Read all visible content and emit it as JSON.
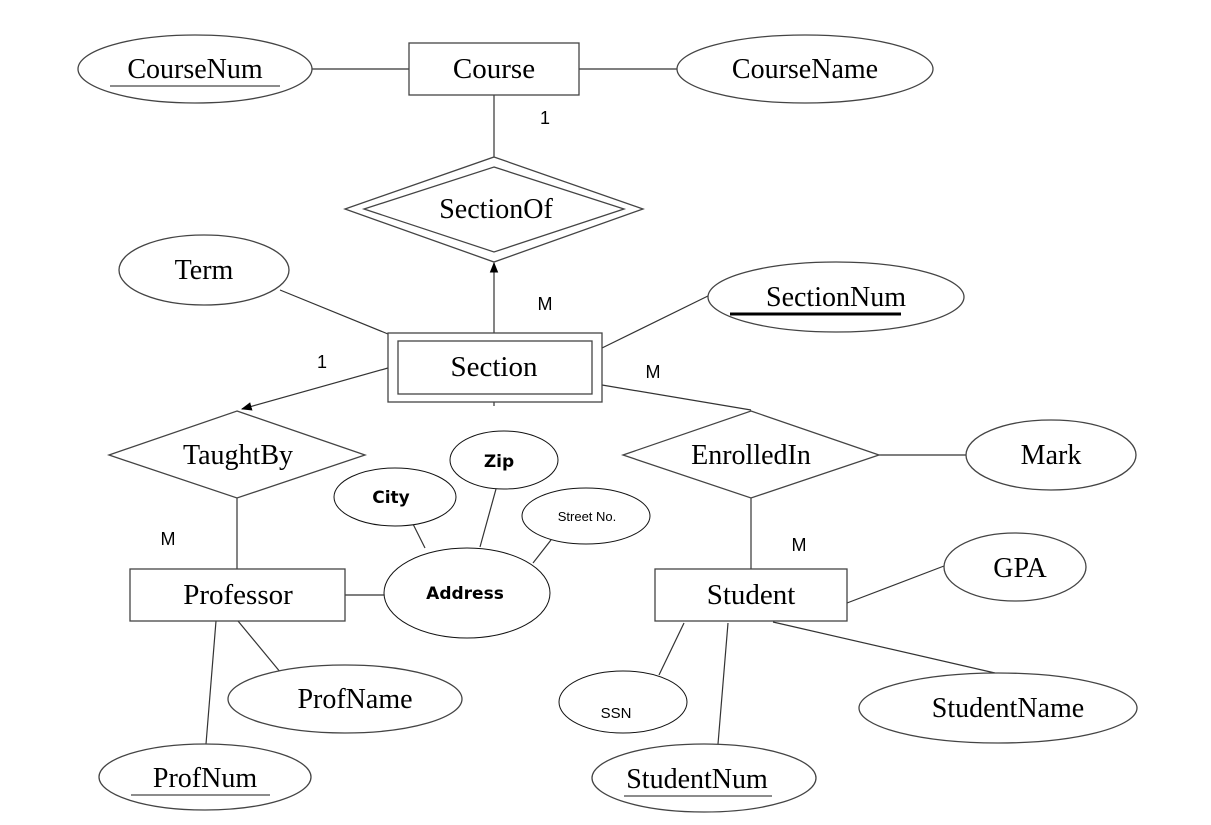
{
  "diagram": {
    "type": "ER diagram",
    "entities": [
      {
        "id": "course",
        "label": "Course",
        "weak": false
      },
      {
        "id": "section",
        "label": "Section",
        "weak": true
      },
      {
        "id": "professor",
        "label": "Professor",
        "weak": false
      },
      {
        "id": "student",
        "label": "Student",
        "weak": false
      }
    ],
    "relationships": [
      {
        "id": "sectionof",
        "label": "SectionOf",
        "identifying": true
      },
      {
        "id": "taughtby",
        "label": "TaughtBy",
        "identifying": false
      },
      {
        "id": "enrolledin",
        "label": "EnrolledIn",
        "identifying": false
      }
    ],
    "attributes": [
      {
        "id": "coursenum",
        "label": "CourseNum",
        "key": true,
        "owner": "course"
      },
      {
        "id": "coursename",
        "label": "CourseName",
        "key": false,
        "owner": "course"
      },
      {
        "id": "term",
        "label": "Term",
        "key": false,
        "owner": "section"
      },
      {
        "id": "sectionnum",
        "label": "SectionNum",
        "key": true,
        "owner": "section"
      },
      {
        "id": "mark",
        "label": "Mark",
        "key": false,
        "owner": "enrolledin"
      },
      {
        "id": "address",
        "label": "Address",
        "key": false,
        "owner": "professor"
      },
      {
        "id": "city",
        "label": "City",
        "key": false,
        "owner": "address"
      },
      {
        "id": "zip",
        "label": "Zip",
        "key": false,
        "owner": "address"
      },
      {
        "id": "streetno",
        "label": "Street No.",
        "key": false,
        "owner": "address"
      },
      {
        "id": "profname",
        "label": "ProfName",
        "key": false,
        "owner": "professor"
      },
      {
        "id": "profnum",
        "label": "ProfNum",
        "key": true,
        "owner": "professor"
      },
      {
        "id": "gpa",
        "label": "GPA",
        "key": false,
        "owner": "student"
      },
      {
        "id": "ssn",
        "label": "SSN",
        "key": false,
        "owner": "student"
      },
      {
        "id": "studentname",
        "label": "StudentName",
        "key": false,
        "owner": "student"
      },
      {
        "id": "studentnum",
        "label": "StudentNum",
        "key": true,
        "owner": "student"
      }
    ],
    "cardinalities": {
      "course_sectionof": "1",
      "section_sectionof": "M",
      "section_taughtby": "1",
      "professor_taughtby": "M",
      "section_enrolledin": "M",
      "student_enrolledin": "M"
    }
  }
}
